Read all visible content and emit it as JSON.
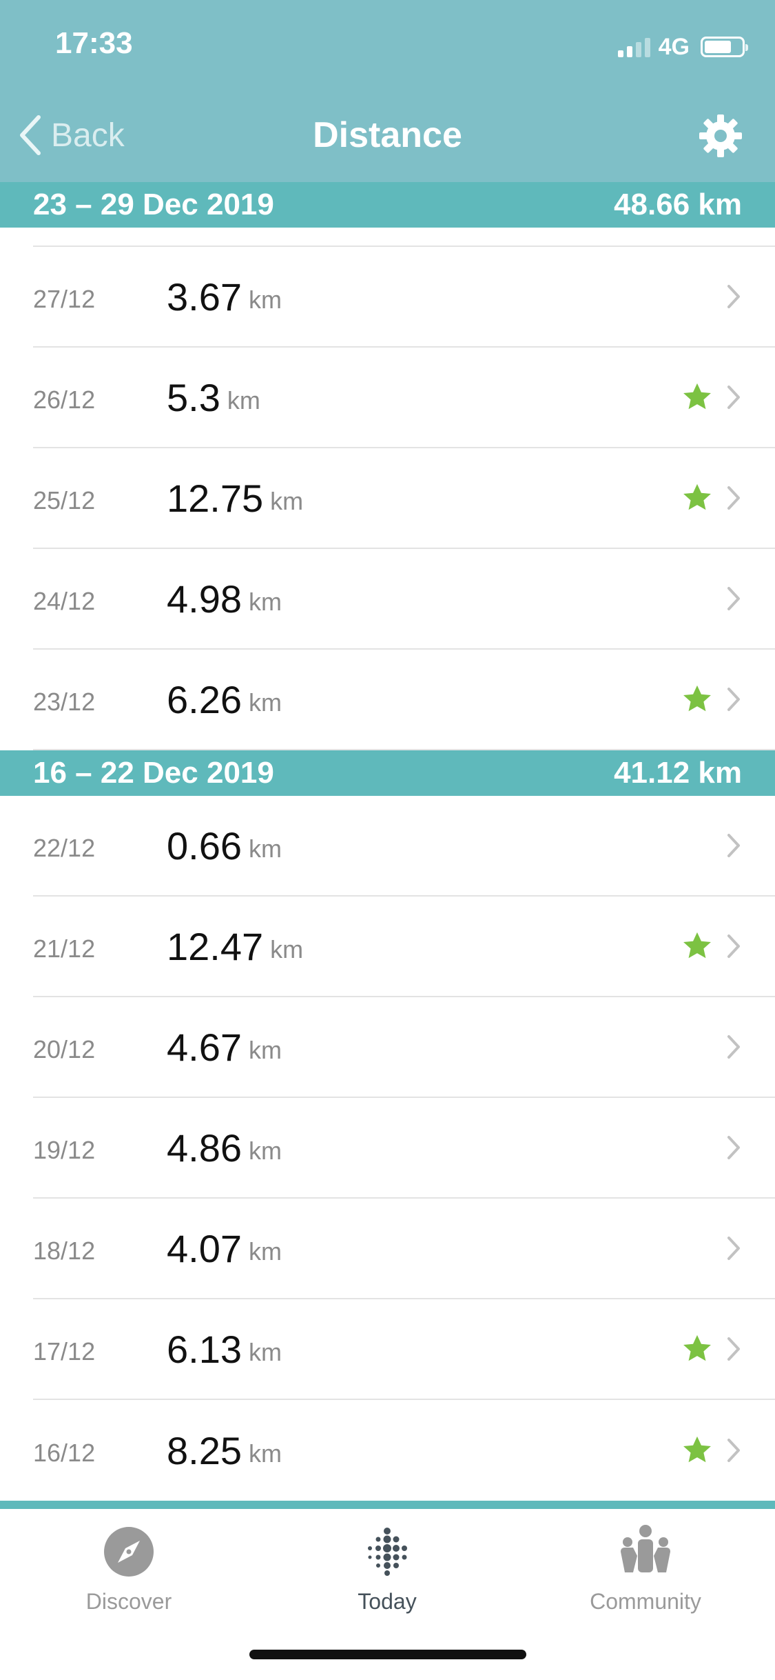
{
  "colors": {
    "header_bg": "#7fbfc7",
    "week_header_bg": "#5fb9bb",
    "star": "#7cc242",
    "chevron": "#c2c2c2",
    "tab_inactive": "#9a9a9a",
    "tab_active": "#45515a"
  },
  "status_bar": {
    "time": "17:33",
    "network": "4G",
    "signal_bars_active": 2,
    "signal_bars_total": 4,
    "battery_level": 0.75
  },
  "nav": {
    "back_label": "Back",
    "title": "Distance",
    "settings_icon": "gear-icon"
  },
  "weeks": [
    {
      "label": "23 – 29 Dec 2019",
      "total": "48.66 km",
      "days": [
        {
          "date": "27/12",
          "value": "3.67",
          "unit": "km",
          "star": false
        },
        {
          "date": "26/12",
          "value": "5.3",
          "unit": "km",
          "star": true
        },
        {
          "date": "25/12",
          "value": "12.75",
          "unit": "km",
          "star": true
        },
        {
          "date": "24/12",
          "value": "4.98",
          "unit": "km",
          "star": false
        },
        {
          "date": "23/12",
          "value": "6.26",
          "unit": "km",
          "star": true
        }
      ]
    },
    {
      "label": "16 – 22 Dec 2019",
      "total": "41.12 km",
      "days": [
        {
          "date": "22/12",
          "value": "0.66",
          "unit": "km",
          "star": false
        },
        {
          "date": "21/12",
          "value": "12.47",
          "unit": "km",
          "star": true
        },
        {
          "date": "20/12",
          "value": "4.67",
          "unit": "km",
          "star": false
        },
        {
          "date": "19/12",
          "value": "4.86",
          "unit": "km",
          "star": false
        },
        {
          "date": "18/12",
          "value": "4.07",
          "unit": "km",
          "star": false
        },
        {
          "date": "17/12",
          "value": "6.13",
          "unit": "km",
          "star": true
        },
        {
          "date": "16/12",
          "value": "8.25",
          "unit": "km",
          "star": true
        }
      ]
    }
  ],
  "tabs": [
    {
      "label": "Discover",
      "icon": "compass-icon",
      "active": false
    },
    {
      "label": "Today",
      "icon": "fitbit-dots-icon",
      "active": true
    },
    {
      "label": "Community",
      "icon": "community-people-icon",
      "active": false
    }
  ]
}
